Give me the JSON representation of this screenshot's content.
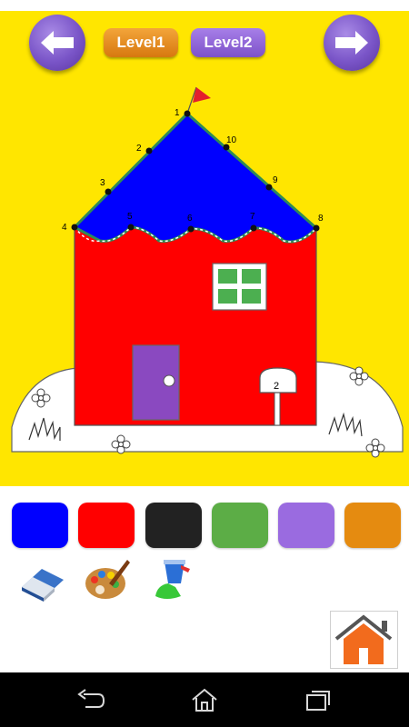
{
  "header": {
    "level1_label": "Level1",
    "level2_label": "Level2"
  },
  "drawing": {
    "dot_labels": [
      "1",
      "2",
      "3",
      "4",
      "5",
      "6",
      "7",
      "8",
      "9",
      "10"
    ],
    "mailbox_number": "2",
    "roof_color": "#0000ff",
    "wall_color": "#ff0000",
    "door_color": "#8a49c0",
    "window_color": "#4caf50",
    "flag_color": "#e3202d"
  },
  "palette": {
    "colors": [
      "#0000ff",
      "#ff0000",
      "#222222",
      "#5cad46",
      "#9a6be0",
      "#e58b10"
    ]
  },
  "tools": [
    "eraser-icon",
    "paint-palette-icon",
    "paint-bucket-icon"
  ],
  "colors": {
    "canvas_bg": "#ffe600",
    "nav_bg": "#000000",
    "home_accent": "#f26b1d"
  }
}
